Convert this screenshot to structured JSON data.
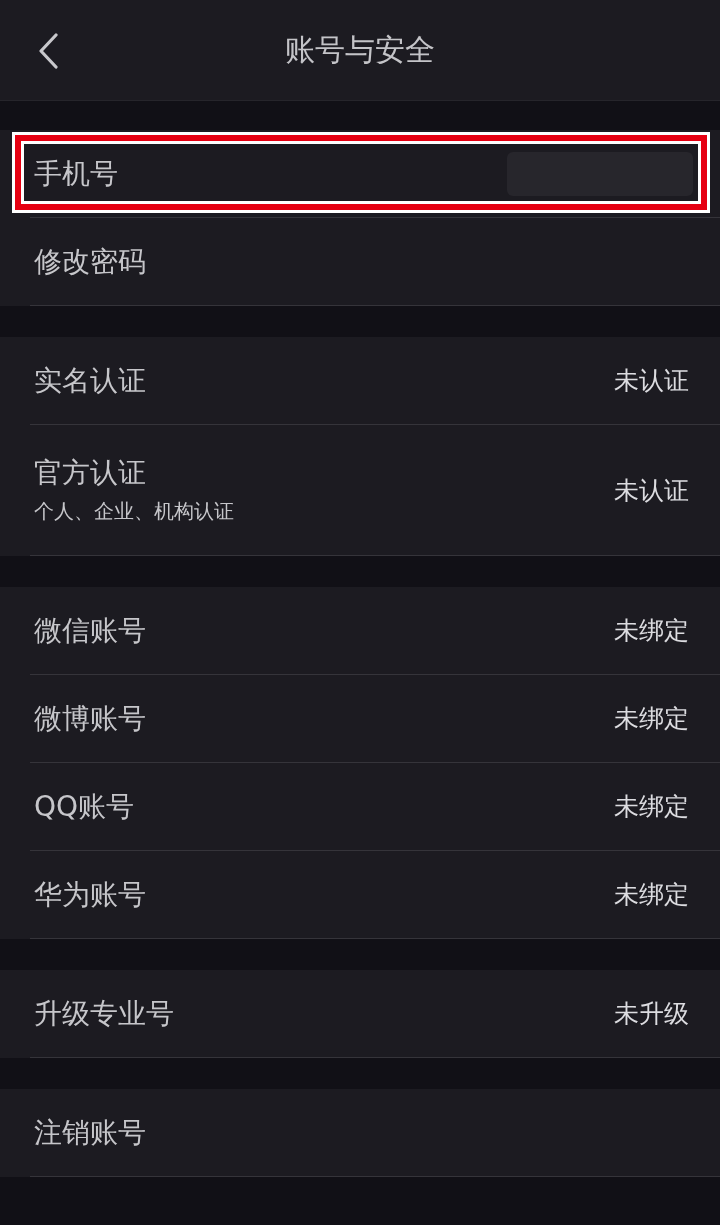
{
  "header": {
    "title": "账号与安全"
  },
  "groups": [
    {
      "rows": [
        {
          "kind": "redacted",
          "label": "手机号",
          "highlighted": true
        },
        {
          "kind": "text",
          "label": "修改密码",
          "highlighted": false
        }
      ]
    },
    {
      "rows": [
        {
          "kind": "status",
          "label": "实名认证",
          "value": "未认证",
          "highlighted": false
        },
        {
          "kind": "status",
          "label": "官方认证",
          "subtitle": "个人、企业、机构认证",
          "value": "未认证",
          "highlighted": false
        }
      ]
    },
    {
      "rows": [
        {
          "kind": "status",
          "label": "微信账号",
          "value": "未绑定",
          "highlighted": false
        },
        {
          "kind": "status",
          "label": "微博账号",
          "value": "未绑定",
          "highlighted": false
        },
        {
          "kind": "status",
          "label": "QQ账号",
          "value": "未绑定",
          "highlighted": false
        },
        {
          "kind": "status",
          "label": "华为账号",
          "value": "未绑定",
          "highlighted": false
        }
      ]
    },
    {
      "rows": [
        {
          "kind": "status",
          "label": "升级专业号",
          "value": "未升级",
          "highlighted": false
        }
      ]
    },
    {
      "rows": [
        {
          "kind": "text",
          "label": "注销账号",
          "highlighted": false
        }
      ]
    }
  ]
}
